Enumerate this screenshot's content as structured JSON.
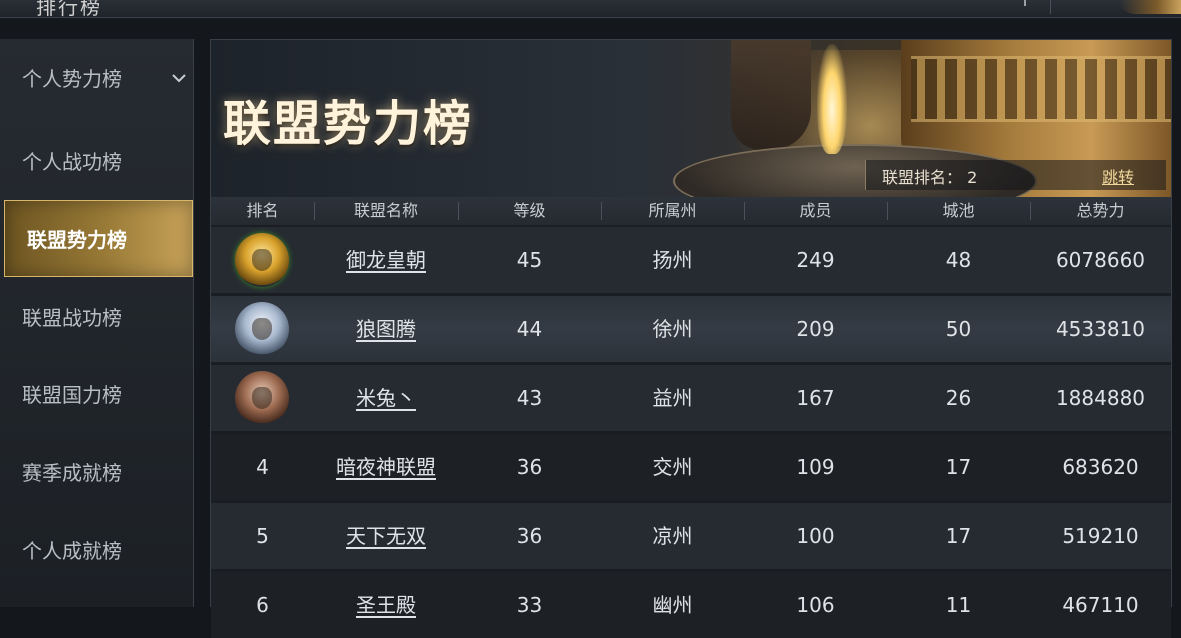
{
  "window": {
    "title": "排行榜"
  },
  "sidebar": {
    "items": [
      {
        "label": "个人势力榜",
        "has_chevron": true,
        "active": false
      },
      {
        "label": "个人战功榜",
        "active": false
      },
      {
        "label": "联盟势力榜",
        "active": true
      },
      {
        "label": "联盟战功榜",
        "active": false
      },
      {
        "label": "联盟国力榜",
        "active": false
      },
      {
        "label": "赛季成就榜",
        "active": false
      },
      {
        "label": "个人成就榜",
        "active": false
      }
    ],
    "chevron_icon": "chevron-down-icon"
  },
  "banner": {
    "title": "联盟势力榜",
    "my_rank_label": "联盟排名：",
    "my_rank_value": "2",
    "jump_label": "跳转"
  },
  "table": {
    "headers": [
      "排名",
      "联盟名称",
      "等级",
      "所属州",
      "成员",
      "城池",
      "总势力"
    ],
    "rows": [
      {
        "rank": "",
        "badge": "gold-medal-icon",
        "name": "御龙皇朝",
        "level": "45",
        "state": "扬州",
        "members": "249",
        "cities": "48",
        "power": "6078660"
      },
      {
        "rank": "",
        "badge": "silver-medal-icon",
        "name": "狼图腾",
        "level": "44",
        "state": "徐州",
        "members": "209",
        "cities": "50",
        "power": "4533810"
      },
      {
        "rank": "",
        "badge": "bronze-medal-icon",
        "name": "米兔丶",
        "level": "43",
        "state": "益州",
        "members": "167",
        "cities": "26",
        "power": "1884880"
      },
      {
        "rank": "4",
        "name": "暗夜神联盟",
        "level": "36",
        "state": "交州",
        "members": "109",
        "cities": "17",
        "power": "683620"
      },
      {
        "rank": "5",
        "name": "天下无双",
        "level": "36",
        "state": "凉州",
        "members": "100",
        "cities": "17",
        "power": "519210"
      },
      {
        "rank": "6",
        "name": "圣王殿",
        "level": "33",
        "state": "幽州",
        "members": "106",
        "cities": "11",
        "power": "467110"
      }
    ]
  },
  "colors": {
    "active_tab": "#b8913f",
    "background": "#1a1e23",
    "title_glow": "#fff3dc"
  }
}
